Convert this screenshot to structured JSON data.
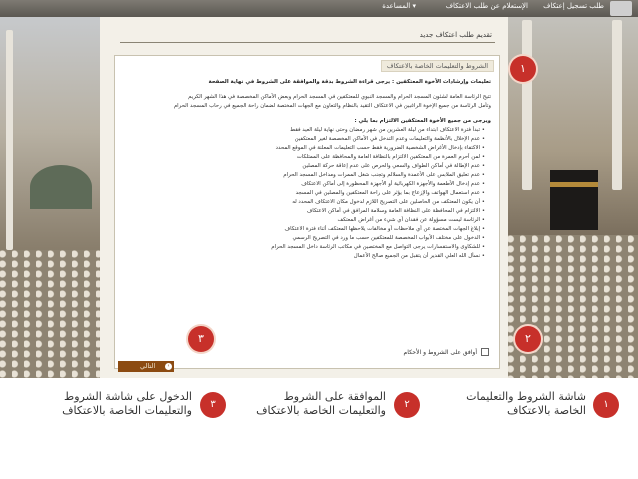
{
  "topbar": {
    "items": [
      "طلب تسجيل إعتكاف",
      "الإستعلام عن طلب الاعتكاف",
      "المساعدة ▾"
    ]
  },
  "panel": {
    "title": "تقديم طلب اعتكاف جديد",
    "section_tab": "الشروط والتعليمات الخاصة بالاعتكاف",
    "lines": [
      {
        "cls": "head",
        "text": "تعليمات وإرشادات الأخوة المعتكفين : يرجى قراءة الشروط بدقة والموافقة على الشروط في نهاية الصفحة"
      },
      {
        "cls": "gap",
        "text": "تتيح الرئاسة العامة لشئون المسجد الحرام والمسجد النبوي للمعتكفين في المسجد الحرام وبعض الأماكن المخصصة في هذا الشهر الكريم"
      },
      {
        "cls": "",
        "text": "وتأمل الرئاسة من جميع الإخوة الراغبين في الاعتكاف التقيد بالنظام والتعاون مع الجهات المختصة لضمان راحة الجميع في رحاب المسجد الحرام"
      },
      {
        "cls": "gap head",
        "text": "ويرجى من جميع الأخوة المعتكفين الالتزام بما يلي :"
      },
      {
        "cls": "item",
        "text": "• تبدأ فترة الاعتكاف ابتداء من ليلة العشرين من شهر رمضان وحتى نهاية ليلة العيد فقط"
      },
      {
        "cls": "item",
        "text": "• عدم الإخلال بالأنظمة والتعليمات وعدم التدخل في الأماكن المخصصة لغير المعتكفين"
      },
      {
        "cls": "item",
        "text": "• الاكتفاء بإدخال الأغراض الشخصية الضرورية فقط حسب التعليمات المعلنة في الموقع المحدد"
      },
      {
        "cls": "item",
        "text": "• لمن أحرم العمرة من المعتكفين الالتزام بالنظافة العامة والمحافظة على الممتلكات"
      },
      {
        "cls": "item",
        "text": "• عدم الإطالة في أماكن الطواف والسعي والحرص على عدم إعاقة حركة المصلين"
      },
      {
        "cls": "item",
        "text": "• عدم تعليق الملابس على الأعمدة والسلالم وتجنب شغل الممرات ومداخل المسجد الحرام"
      },
      {
        "cls": "item",
        "text": "• عدم إدخال الأطعمة والأجهزة الكهربائية أو الأجهزة المحظورة إلى أماكن الاعتكاف"
      },
      {
        "cls": "item",
        "text": "• عدم استعمال الهواتف والإزعاج بما يؤثر على راحة المعتكفين والمصلين في المسجد"
      },
      {
        "cls": "item",
        "text": "• أن يكون المعتكف من الحاصلين على التصريح اللازم لدخول مكان الاعتكاف المحدد له"
      },
      {
        "cls": "item",
        "text": "• الالتزام في المحافظة على النظافة العامة وسلامة المرافق في أماكن الاعتكاف"
      },
      {
        "cls": "item",
        "text": "• الرئاسة ليست مسؤولة عن فقدان أي شيء من أغراض المعتكف"
      },
      {
        "cls": "item",
        "text": "• إبلاغ الجهات المختصة عن أي ملاحظات أو مخالفات يلاحظها المعتكف أثناء فترة الاعتكاف"
      },
      {
        "cls": "item",
        "text": "• الدخول على مختلف الأبواب المخصصة للمعتكفين حسب ما ورد في التصريح الرسمي"
      },
      {
        "cls": "item",
        "text": "• للشكاوى والاستفسارات يرجى التواصل مع المختصين في مكاتب الرئاسة داخل المسجد الحرام"
      },
      {
        "cls": "item",
        "text": "• نسأل الله العلي القدير أن يتقبل من الجميع صالح الأعمال"
      }
    ],
    "agree_label": "أوافق على الشروط و الأحكام",
    "next_label": "التالي",
    "next_arrow": "‹"
  },
  "markers": [
    "١",
    "٢",
    "٣"
  ],
  "legend": [
    {
      "num": "١",
      "text": "شاشة الشروط والتعليمات الخاصة بالاعتكاف"
    },
    {
      "num": "٢",
      "text": "الموافقة على الشروط والتعليمات الخاصة بالاعتكاف"
    },
    {
      "num": "٣",
      "text": "الدخول على شاشة الشروط والتعليمات الخاصة بالاعتكاف"
    }
  ],
  "colors": {
    "marker_red": "#c7302a",
    "button_brown": "#8c4b12",
    "panel_bg": "#f3f0e8"
  }
}
